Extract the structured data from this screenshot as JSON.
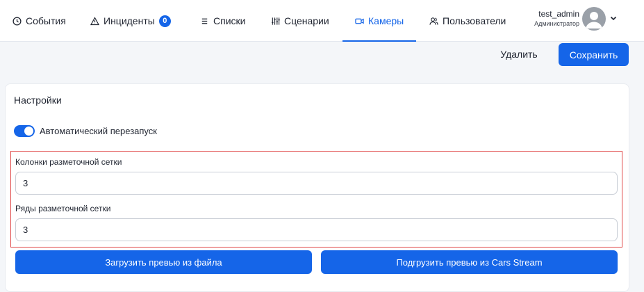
{
  "nav": {
    "items": [
      {
        "label": "События",
        "icon": "clock-icon"
      },
      {
        "label": "Инциденты",
        "icon": "warning-icon",
        "badge": "0"
      },
      {
        "label": "Списки",
        "icon": "list-icon"
      },
      {
        "label": "Сценарии",
        "icon": "sliders-icon"
      },
      {
        "label": "Камеры",
        "icon": "camera-icon",
        "active": true
      },
      {
        "label": "Пользователи",
        "icon": "users-icon"
      }
    ],
    "user": {
      "name": "test_admin",
      "role": "Администратор"
    }
  },
  "actions": {
    "delete_label": "Удалить",
    "save_label": "Сохранить"
  },
  "settings": {
    "title": "Настройки",
    "auto_restart": {
      "label": "Автоматический перезапуск",
      "enabled": true
    },
    "grid_columns": {
      "label": "Колонки разметочной сетки",
      "value": "3"
    },
    "grid_rows": {
      "label": "Ряды разметочной сетки",
      "value": "3"
    },
    "upload_preview_label": "Загрузить превью из файла",
    "fetch_preview_label": "Подгрузить превью из Cars Stream"
  },
  "colors": {
    "accent": "#1565e8",
    "highlight_border": "#e04848",
    "nav_text": "#1f2430"
  }
}
